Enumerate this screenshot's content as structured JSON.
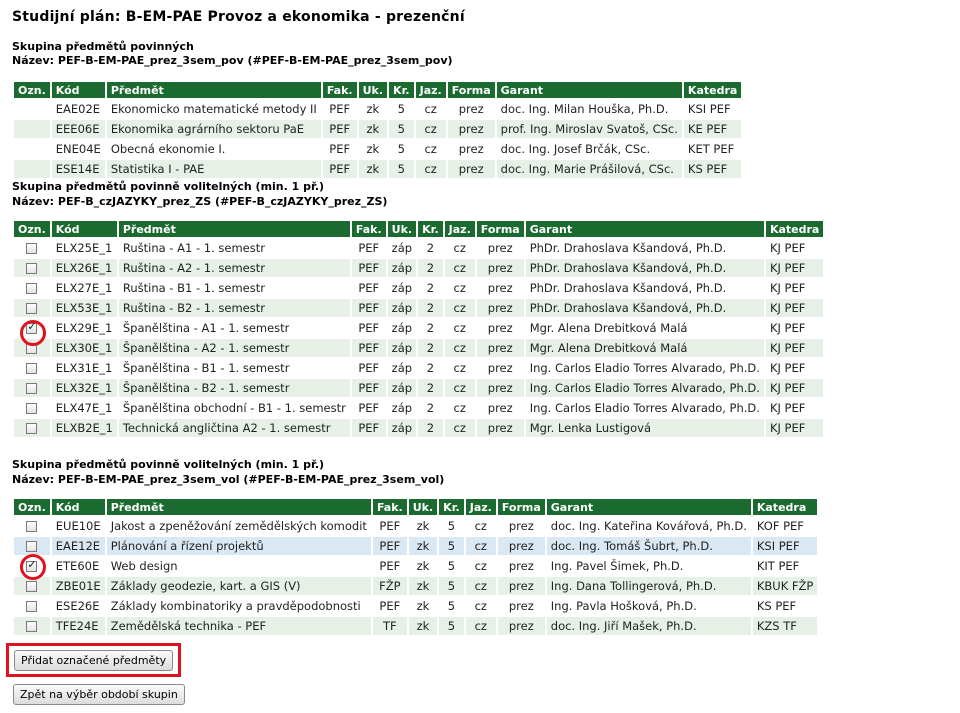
{
  "page_title": "Studijní plán: B-EM-PAE Provoz a ekonomika - prezenční",
  "headers1": [
    "Ozn.",
    "Kód",
    "Předmět",
    "Fak.",
    "Uk.",
    "Kr.",
    "Jaz.",
    "Forma",
    "Garant",
    "Katedra"
  ],
  "group1": {
    "heading": "Skupina předmětů povinných",
    "name": "Název: PEF-B-EM-PAE_prez_3sem_pov (#PEF-B-EM-PAE_prez_3sem_pov)",
    "rows": [
      {
        "kod": "EAE02E",
        "predmet": "Ekonomicko matematické metody II",
        "fak": "PEF",
        "uk": "zk",
        "kr": "5",
        "jaz": "cz",
        "forma": "prez",
        "garant": "doc. Ing. Milan Houška, Ph.D.",
        "katedra": "KSI PEF"
      },
      {
        "kod": "EEE06E",
        "predmet": "Ekonomika agrárního sektoru PaE",
        "fak": "PEF",
        "uk": "zk",
        "kr": "5",
        "jaz": "cz",
        "forma": "prez",
        "garant": "prof. Ing. Miroslav Svatoš, CSc.",
        "katedra": "KE PEF"
      },
      {
        "kod": "ENE04E",
        "predmet": "Obecná ekonomie I.",
        "fak": "PEF",
        "uk": "zk",
        "kr": "5",
        "jaz": "cz",
        "forma": "prez",
        "garant": "doc. Ing. Josef Brčák, CSc.",
        "katedra": "KET PEF"
      },
      {
        "kod": "ESE14E",
        "predmet": "Statistika I - PAE",
        "fak": "PEF",
        "uk": "zk",
        "kr": "5",
        "jaz": "cz",
        "forma": "prez",
        "garant": "doc. Ing. Marie Prášilová, CSc.",
        "katedra": "KS PEF"
      }
    ]
  },
  "group2": {
    "heading": "Skupina předmětů povinně volitelných (min. 1 př.)",
    "name": "Název: PEF-B_czJAZYKY_prez_ZS (#PEF-B_czJAZYKY_prez_ZS)",
    "rows": [
      {
        "checked": false,
        "kod": "ELX25E_1",
        "predmet": "Ruština - A1 - 1. semestr",
        "fak": "PEF",
        "uk": "záp",
        "kr": "2",
        "jaz": "cz",
        "forma": "prez",
        "garant": "PhDr. Drahoslava Kšandová, Ph.D.",
        "katedra": "KJ PEF"
      },
      {
        "checked": false,
        "kod": "ELX26E_1",
        "predmet": "Ruština - A2 - 1. semestr",
        "fak": "PEF",
        "uk": "záp",
        "kr": "2",
        "jaz": "cz",
        "forma": "prez",
        "garant": "PhDr. Drahoslava Kšandová, Ph.D.",
        "katedra": "KJ PEF"
      },
      {
        "checked": false,
        "kod": "ELX27E_1",
        "predmet": "Ruština - B1 - 1. semestr",
        "fak": "PEF",
        "uk": "záp",
        "kr": "2",
        "jaz": "cz",
        "forma": "prez",
        "garant": "PhDr. Drahoslava Kšandová, Ph.D.",
        "katedra": "KJ PEF"
      },
      {
        "checked": false,
        "kod": "ELX53E_1",
        "predmet": "Ruština - B2 - 1. semestr",
        "fak": "PEF",
        "uk": "záp",
        "kr": "2",
        "jaz": "cz",
        "forma": "prez",
        "garant": "PhDr. Drahoslava Kšandová, Ph.D.",
        "katedra": "KJ PEF"
      },
      {
        "checked": true,
        "kod": "ELX29E_1",
        "predmet": "Španělština - A1 - 1. semestr",
        "fak": "PEF",
        "uk": "záp",
        "kr": "2",
        "jaz": "cz",
        "forma": "prez",
        "garant": "Mgr. Alena Drebitková Malá",
        "katedra": "KJ PEF"
      },
      {
        "checked": false,
        "kod": "ELX30E_1",
        "predmet": "Španělština - A2 - 1. semestr",
        "fak": "PEF",
        "uk": "záp",
        "kr": "2",
        "jaz": "cz",
        "forma": "prez",
        "garant": "Mgr. Alena Drebitková Malá",
        "katedra": "KJ PEF"
      },
      {
        "checked": false,
        "kod": "ELX31E_1",
        "predmet": "Španělština - B1 - 1. semestr",
        "fak": "PEF",
        "uk": "záp",
        "kr": "2",
        "jaz": "cz",
        "forma": "prez",
        "garant": "Ing. Carlos Eladio Torres Alvarado, Ph.D.",
        "katedra": "KJ PEF"
      },
      {
        "checked": false,
        "kod": "ELX32E_1",
        "predmet": "Španělština - B2 - 1. semestr",
        "fak": "PEF",
        "uk": "záp",
        "kr": "2",
        "jaz": "cz",
        "forma": "prez",
        "garant": "Ing. Carlos Eladio Torres Alvarado, Ph.D.",
        "katedra": "KJ PEF"
      },
      {
        "checked": false,
        "kod": "ELX47E_1",
        "predmet": "Španělština obchodní - B1 - 1. semestr",
        "fak": "PEF",
        "uk": "záp",
        "kr": "2",
        "jaz": "cz",
        "forma": "prez",
        "garant": "Ing. Carlos Eladio Torres Alvarado, Ph.D.",
        "katedra": "KJ PEF"
      },
      {
        "checked": false,
        "kod": "ELXB2E_1",
        "predmet": "Technická angličtina A2 - 1. semestr",
        "fak": "PEF",
        "uk": "záp",
        "kr": "2",
        "jaz": "cz",
        "forma": "prez",
        "garant": "Mgr. Lenka Lustigová",
        "katedra": "KJ PEF"
      }
    ]
  },
  "group3": {
    "heading": "Skupina předmětů povinně volitelných (min. 1 př.)",
    "name": "Název: PEF-B-EM-PAE_prez_3sem_vol (#PEF-B-EM-PAE_prez_3sem_vol)",
    "rows": [
      {
        "checked": false,
        "kod": "EUE10E",
        "predmet": "Jakost a zpeněžování zemědělských komodit",
        "fak": "PEF",
        "uk": "zk",
        "kr": "5",
        "jaz": "cz",
        "forma": "prez",
        "garant": "doc. Ing. Kateřina Kovářová, Ph.D.",
        "katedra": "KOF PEF"
      },
      {
        "checked": false,
        "kod": "EAE12E",
        "predmet": "Plánování a řízení projektů",
        "fak": "PEF",
        "uk": "zk",
        "kr": "5",
        "jaz": "cz",
        "forma": "prez",
        "garant": "doc. Ing. Tomáš Šubrt, Ph.D.",
        "katedra": "KSI PEF",
        "highlight": true
      },
      {
        "checked": true,
        "kod": "ETE60E",
        "predmet": "Web design",
        "fak": "PEF",
        "uk": "zk",
        "kr": "5",
        "jaz": "cz",
        "forma": "prez",
        "garant": "Ing. Pavel Šimek, Ph.D.",
        "katedra": "KIT PEF"
      },
      {
        "checked": false,
        "kod": "ZBE01E",
        "predmet": "Základy geodezie, kart. a GIS (V)",
        "fak": "FŽP",
        "uk": "zk",
        "kr": "5",
        "jaz": "cz",
        "forma": "prez",
        "garant": "Ing. Dana Tollingerová, Ph.D.",
        "katedra": "KBUK FŽP"
      },
      {
        "checked": false,
        "kod": "ESE26E",
        "predmet": "Základy kombinatoriky a pravděpodobnosti",
        "fak": "PEF",
        "uk": "zk",
        "kr": "5",
        "jaz": "cz",
        "forma": "prez",
        "garant": "Ing. Pavla Hošková, Ph.D.",
        "katedra": "KS PEF"
      },
      {
        "checked": false,
        "kod": "TFE24E",
        "predmet": "Zemědělská technika - PEF",
        "fak": "TF",
        "uk": "zk",
        "kr": "5",
        "jaz": "cz",
        "forma": "prez",
        "garant": "doc. Ing. Jiří Mašek, Ph.D.",
        "katedra": "KZS TF"
      }
    ]
  },
  "buttons": {
    "add_selected": "Přidat označené předměty",
    "back": "Zpět na výběr období skupin"
  },
  "colors": {
    "header_bg": "#1b6b30",
    "link": "#2c6e2f",
    "row_alt": "#e6f0e6",
    "row_highlight": "#d9e8f2",
    "annotation_red": "#e0121f"
  }
}
